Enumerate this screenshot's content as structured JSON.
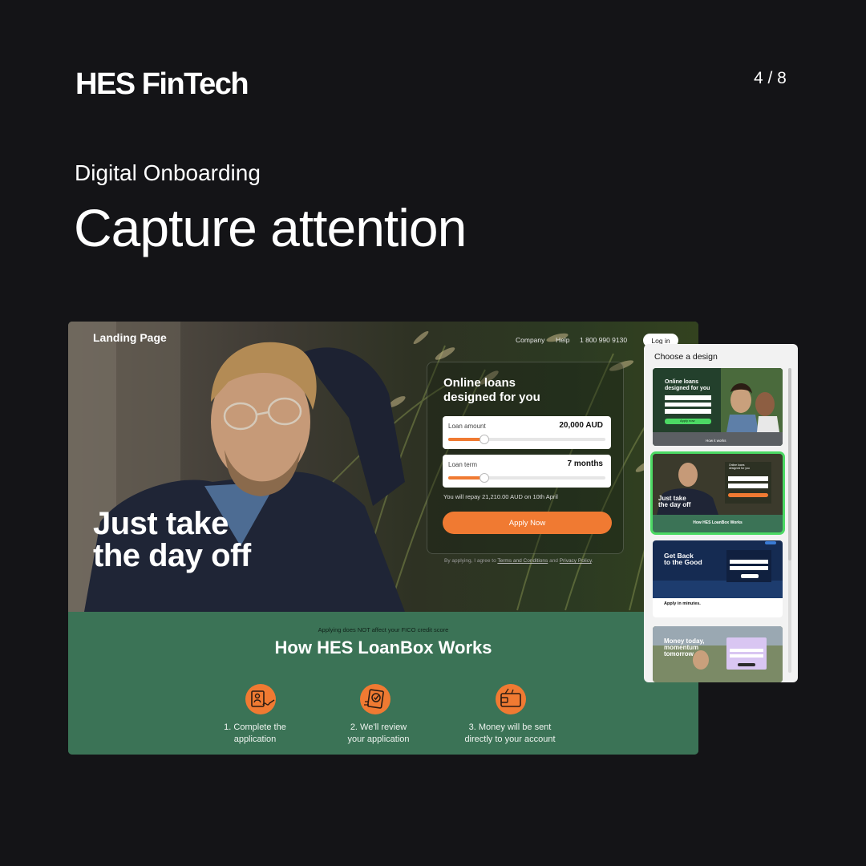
{
  "header": {
    "brand": "HES FinTech",
    "pager": "4 / 8",
    "eyebrow": "Digital Onboarding",
    "headline": "Capture attention"
  },
  "landing": {
    "logo": "Landing Page",
    "nav": {
      "company": "Company",
      "help": "Help",
      "phone": "1 800 990 9130",
      "login": "Log in"
    },
    "hero_line1": "Just take",
    "hero_line2": "the day off",
    "form": {
      "title_line1": "Online loans",
      "title_line2": "designed for you",
      "loan_amount_label": "Loan amount",
      "loan_amount_value": "20,000 AUD",
      "loan_amount_position": 0.23,
      "loan_term_label": "Loan term",
      "loan_term_value": "7 months",
      "loan_term_position": 0.23,
      "repay_text": "You will repay 21,210.00 AUD on 10th April",
      "apply_label": "Apply Now",
      "terms_prefix": "By applying, I agree to",
      "terms_link": "Terms and Conditions",
      "terms_and": "and",
      "privacy_link": "Privacy Policy"
    },
    "fico_note": "Applying does NOT affect your FICO credit score",
    "how_title": "How HES LoanBox Works",
    "steps": [
      {
        "line1": "1. Complete the",
        "line2": "application",
        "icon": "signature-document-icon"
      },
      {
        "line1": "2. We'll review",
        "line2": "your application",
        "icon": "review-checkmark-icon"
      },
      {
        "line1": "3. Money will be sent",
        "line2": "directly to your account",
        "icon": "wallet-icon"
      }
    ]
  },
  "chooser": {
    "title": "Choose a design",
    "designs": [
      {
        "title_line1": "Online loans",
        "title_line2": "designed for you",
        "cta": "Apply now",
        "foot": "How it works",
        "selected": false
      },
      {
        "title_line1": "Just take",
        "title_line2": "the day off",
        "foot": "How HES LoanBox Works",
        "selected": true
      },
      {
        "title_line1": "Get Back",
        "title_line2": "to the Good",
        "sub": "Apply in minutes.",
        "selected": false
      },
      {
        "title_line1": "Money today,",
        "title_line2": "momentum",
        "title_line3": "tomorrow",
        "selected": false
      }
    ]
  },
  "colors": {
    "background": "#141417",
    "accent_orange": "#f07a32",
    "green": "#3b7356",
    "selected_border": "#4cd964"
  }
}
